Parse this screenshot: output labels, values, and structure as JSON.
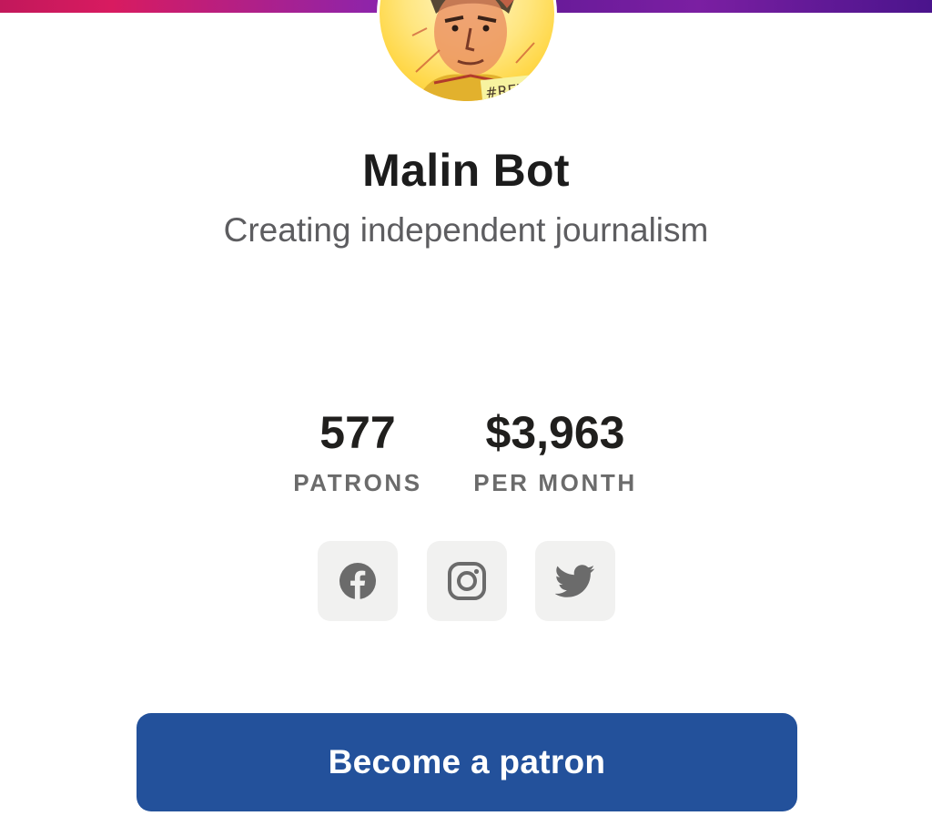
{
  "creator": {
    "name": "Malin Bot",
    "tagline": "Creating independent journalism",
    "avatar_text": "#REZI"
  },
  "stats": {
    "patrons_value": "577",
    "patrons_label": "PATRONS",
    "money_value": "$3,963",
    "money_label": "PER MONTH"
  },
  "social": [
    {
      "name": "facebook",
      "icon": "facebook-icon"
    },
    {
      "name": "instagram",
      "icon": "instagram-icon"
    },
    {
      "name": "twitter",
      "icon": "twitter-icon"
    }
  ],
  "cta": {
    "label": "Become a patron"
  },
  "colors": {
    "cta_background": "#23519b",
    "icon_color": "#6b6b6b",
    "social_button_bg": "#f1f1f0"
  }
}
